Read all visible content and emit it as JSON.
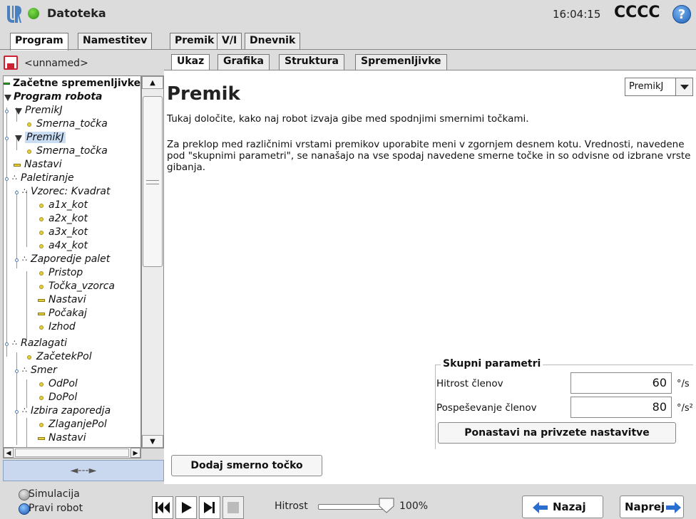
{
  "topbar": {
    "file_label": "Datoteka",
    "clock": "16:04:15",
    "robot_name": "CCCC",
    "help_glyph": "?"
  },
  "main_tabs": [
    {
      "label": "Program",
      "active": true
    },
    {
      "label": "Namestitev",
      "active": false
    },
    {
      "label": "Premik",
      "active": false
    },
    {
      "label": "V/I",
      "active": false
    },
    {
      "label": "Dnevnik",
      "active": false
    }
  ],
  "program": {
    "name": "<unnamed>"
  },
  "tree": [
    {
      "label": "Začetne spremenljivke",
      "icon": "variable-icon",
      "bold": true,
      "italic": false
    },
    {
      "label": "Program robota",
      "icon": "triangle-icon",
      "bold": true,
      "italic": true
    },
    {
      "label": "PremikJ",
      "icon": "triangle-icon"
    },
    {
      "label": "Smerna_točka",
      "icon": "waypoint-icon"
    },
    {
      "label": "PremikJ",
      "icon": "triangle-icon",
      "selected": true
    },
    {
      "label": "Smerna_točka",
      "icon": "waypoint-icon"
    },
    {
      "label": "Nastavi",
      "icon": "set-icon"
    },
    {
      "label": "Paletiranje",
      "icon": "pallet-icon"
    },
    {
      "label": "Vzorec: Kvadrat",
      "icon": "pallet-icon"
    },
    {
      "label": "a1x_kot",
      "icon": "waypoint-icon"
    },
    {
      "label": "a2x_kot",
      "icon": "waypoint-icon"
    },
    {
      "label": "a3x_kot",
      "icon": "waypoint-icon"
    },
    {
      "label": "a4x_kot",
      "icon": "waypoint-icon"
    },
    {
      "label": "Zaporedje palet",
      "icon": "pallet-icon"
    },
    {
      "label": "Pristop",
      "icon": "waypoint-icon"
    },
    {
      "label": "Točka_vzorca",
      "icon": "waypoint-icon"
    },
    {
      "label": "Nastavi",
      "icon": "set-icon"
    },
    {
      "label": "Počakaj",
      "icon": "set-icon"
    },
    {
      "label": "Izhod",
      "icon": "waypoint-icon"
    },
    {
      "label": "Razlagati",
      "icon": "pallet-icon"
    },
    {
      "label": "ZačetekPol",
      "icon": "waypoint-icon"
    },
    {
      "label": "Smer",
      "icon": "pallet-icon"
    },
    {
      "label": "OdPol",
      "icon": "waypoint-icon"
    },
    {
      "label": "DoPol",
      "icon": "waypoint-icon"
    },
    {
      "label": "Izbira zaporedja",
      "icon": "pallet-icon"
    },
    {
      "label": "ZlaganjePol",
      "icon": "waypoint-icon"
    },
    {
      "label": "Nastavi",
      "icon": "set-icon"
    }
  ],
  "collapse_arrow": "◄---►",
  "sub_tabs": [
    {
      "label": "Ukaz",
      "active": true
    },
    {
      "label": "Grafika",
      "active": false
    },
    {
      "label": "Struktura",
      "active": false
    },
    {
      "label": "Spremenljivke",
      "active": false
    }
  ],
  "command": {
    "title": "Premik",
    "move_type": "PremikJ",
    "desc1": "Tukaj določite, kako naj robot izvaja gibe med spodnjimi smernimi točkami.",
    "desc2": "Za preklop med različnimi vrstami premikov uporabite meni v zgornjem desnem kotu. Vrednosti, navedene pod \"skupnimi parametri\", se nanašajo na vse spodaj navedene smerne točke in so odvisne od izbrane vrste gibanja.",
    "shared_params": {
      "title": "Skupni parametri",
      "joint_speed_label": "Hitrost členov",
      "joint_speed_value": "60",
      "joint_speed_unit": "°/s",
      "joint_accel_label": "Pospeševanje členov",
      "joint_accel_value": "80",
      "joint_accel_unit": "°/s²",
      "reset_label": "Ponastavi na privzete nastavitve"
    },
    "add_waypoint_label": "Dodaj smerno točko"
  },
  "bottombar": {
    "simulation_label": "Simulacija",
    "real_robot_label": "Pravi robot",
    "speed_label": "Hitrost",
    "speed_value": "100%",
    "speed_fraction": 1.0,
    "back_label": "Nazaj",
    "next_label": "Naprej"
  },
  "colors": {
    "selected_row": "#c8dcf4",
    "collapse_bar": "#c9d8ee",
    "arrow_blue": "#2a6fd0"
  }
}
